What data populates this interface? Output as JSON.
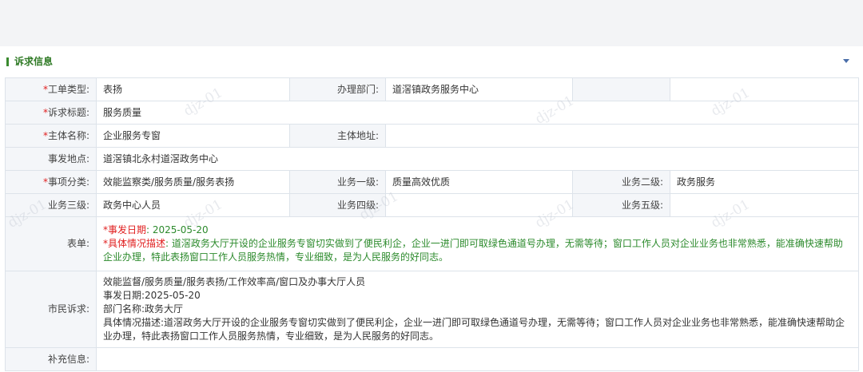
{
  "section": {
    "title": "诉求信息"
  },
  "fields": {
    "ticket_type": {
      "label": "工单类型:",
      "value": "表扬"
    },
    "handling_dept": {
      "label": "办理部门:",
      "value": "道滘镇政务服务中心"
    },
    "title": {
      "label": "诉求标题:",
      "value": "服务质量"
    },
    "subject_name": {
      "label": "主体名称:",
      "value": "企业服务专窗"
    },
    "subject_address": {
      "label": "主体地址:",
      "value": ""
    },
    "location": {
      "label": "事发地点:",
      "value": "道滘镇北永村道滘政务中心"
    },
    "category": {
      "label": "事项分类:",
      "value": "效能监察类/服务质量/服务表扬"
    },
    "biz_level1": {
      "label": "业务一级:",
      "value": "质量高效优质"
    },
    "biz_level2": {
      "label": "业务二级:",
      "value": "政务服务"
    },
    "biz_level3": {
      "label": "业务三级:",
      "value": "政务中心人员"
    },
    "biz_level4": {
      "label": "业务四级:",
      "value": ""
    },
    "biz_level5": {
      "label": "业务五级:",
      "value": ""
    },
    "form": {
      "label": "表单:",
      "date_label": "*事发日期",
      "date_value": ": 2025-05-20",
      "desc_label": "*具体情况描述",
      "desc_value": ": 道滘政务大厅开设的企业服务专窗切实做到了便民利企，企业一进门即可取绿色通道号办理，无需等待；窗口工作人员对企业业务也非常熟悉，能准确快速帮助企业办理，特此表扬窗口工作人员服务热情，专业细致，是为人民服务的好同志。"
    },
    "citizen_request": {
      "label": "市民诉求:",
      "lines": [
        "效能监督/服务质量/服务表扬/工作效率高/窗口及办事大厅人员",
        "事发日期:2025-05-20",
        "部门名称:政务大厅",
        "具体情况描述:道滘政务大厅开设的企业服务专窗切实做到了便民利企，企业一进门即可取绿色通道号办理，无需等待；窗口工作人员对企业业务也非常熟悉，能准确快速帮助企业办理，特此表扬窗口工作人员服务热情，专业细致，是为人民服务的好同志。"
      ]
    },
    "supplement": {
      "label": "补充信息:"
    }
  },
  "required_mark": "*",
  "watermark": "djz-01",
  "colors": {
    "accent_green": "#2f7a25",
    "required_red": "#e02020",
    "label_bg": "#f4f6f9",
    "border": "#dde3ea"
  }
}
